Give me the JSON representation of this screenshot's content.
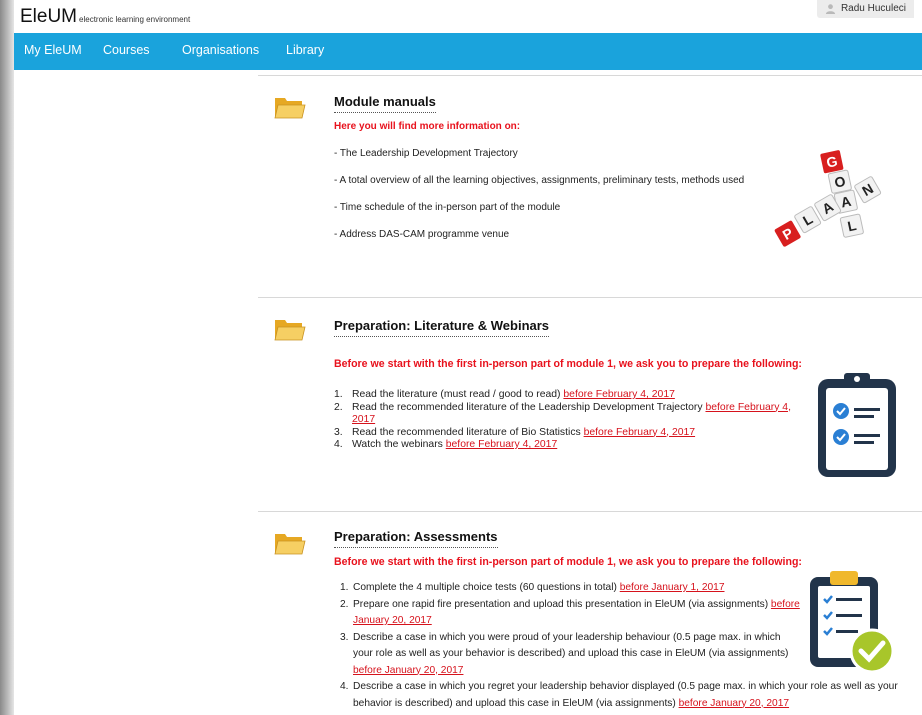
{
  "header": {
    "logo_main": "EleUM",
    "logo_sub": "electronic learning environment",
    "user_name": "Radu Huculeci"
  },
  "nav": {
    "items": [
      {
        "label": "My EleUM"
      },
      {
        "label": "Courses"
      },
      {
        "label": "Organisations"
      },
      {
        "label": "Library"
      }
    ]
  },
  "sections": {
    "manuals": {
      "title": "Module manuals",
      "red_intro": "Here you will find more information on:",
      "items": [
        "- The Leadership Development Trajectory",
        "- A total overview of all the learning objectives, assignments, preliminary tests, methods used",
        "- Time schedule of the in-person part of the module",
        "- Address DAS-CAM programme venue"
      ]
    },
    "literature": {
      "title": "Preparation: Literature & Webinars",
      "red_intro": "Before we start with the first in-person part of module 1, we ask you to prepare the following:",
      "items": [
        {
          "num": "1.",
          "text": "Read the literature  (must read / good to read) ",
          "link": "before February 4, 2017"
        },
        {
          "num": "2.",
          "text": "Read the recommended literature of the Leadership Development Trajectory ",
          "link": "before February 4, 2017"
        },
        {
          "num": "3.",
          "text": "Read the recommended literature of Bio Statistics ",
          "link": "before February 4, 2017"
        },
        {
          "num": "4.",
          "text": "Watch the webinars ",
          "link": "before February 4, 2017"
        }
      ]
    },
    "assessments": {
      "title": "Preparation: Assessments",
      "red_intro": "Before we start with the first in-person part of module 1, we ask you to prepare the following:",
      "items": [
        {
          "num": "1.",
          "text": "Complete the 4 multiple choice tests (60 questions in total) ",
          "link": "before January 1, 2017"
        },
        {
          "num": "2.",
          "text": "Prepare one rapid fire presentation and upload this presentation in EleUM (via assignments) ",
          "link": "before January 20, 2017"
        },
        {
          "num": "3.",
          "text": "Describe a case in which you were proud of your leadership behaviour (0.5 page max. in which your role as well as your behavior is described) and upload this case in EleUM (via assignments)  ",
          "link": "before January 20, 2017"
        },
        {
          "num": "4.",
          "text": "Describe a case in which you regret your leadership behavior displayed (0.5 page max. in which your role as well as your behavior is described) and upload this case in EleUM (via assignments)  ",
          "link": "before January 20, 2017"
        }
      ]
    }
  },
  "images": {
    "goal_plan_letters": [
      "G",
      "O",
      "A",
      "L",
      "P",
      "L",
      "A",
      "N"
    ]
  },
  "colors": {
    "nav_bg": "#1aa3dc",
    "red_text": "#e8121d",
    "link": "#d6121c",
    "folder": "#f2c14e"
  },
  "icons": {
    "section": "folder-icon",
    "user": "user-icon"
  }
}
